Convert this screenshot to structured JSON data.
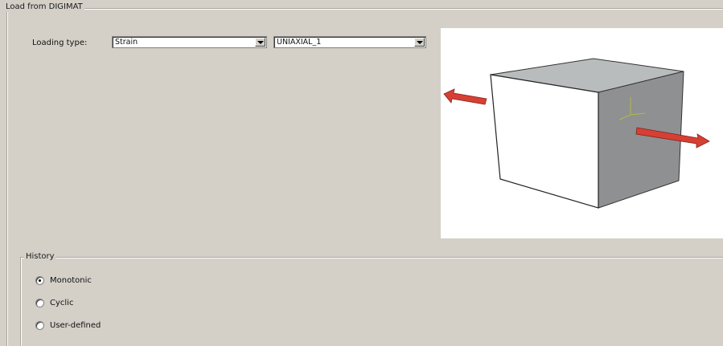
{
  "group_title": "Load from DIGIMAT",
  "loading": {
    "label": "Loading type:",
    "type_value": "Strain",
    "case_value": "UNIAXIAL_1"
  },
  "history": {
    "title": "History",
    "options": [
      {
        "label": "Monotonic",
        "checked": true
      },
      {
        "label": "Cyclic",
        "checked": false
      },
      {
        "label": "User-defined",
        "checked": false
      }
    ]
  },
  "icons": {
    "preview": "uniaxial-cube-icon",
    "arrow_color": "#d64034"
  },
  "colors": {
    "panel_bg": "#d4d0c8",
    "preview_bg": "#ffffff",
    "cube_front": "#ffffff",
    "cube_top": "#b9bcbd",
    "cube_side": "#8e9092"
  }
}
